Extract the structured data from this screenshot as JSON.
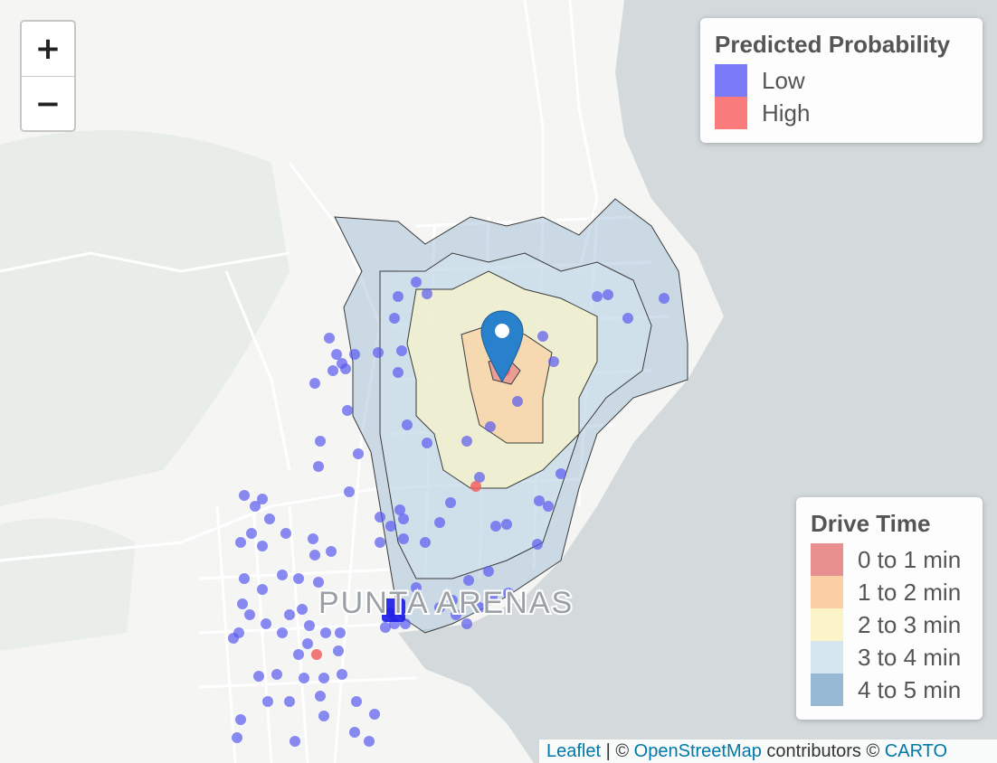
{
  "map": {
    "city_label": "PUNTA ARENAS",
    "colors": {
      "land": "#f5f5f3",
      "water": "#d4dadc",
      "park": "#e6ece6",
      "roads": "#ffffff",
      "point_low": "#5a5af0",
      "point_high": "#f06060",
      "marker": "#2a81cb"
    },
    "marker_icon": "map-pin-icon",
    "layers": [
      "drive-time-isochrones",
      "predicted-probability-points",
      "location-marker"
    ]
  },
  "zoom": {
    "in_label": "+",
    "out_label": "−"
  },
  "legend_probability": {
    "title": "Predicted Probability",
    "items": [
      {
        "label": "Low",
        "color": "#7b7bfa"
      },
      {
        "label": "High",
        "color": "#fa7b7b"
      }
    ]
  },
  "legend_drive_time": {
    "title": "Drive Time",
    "items": [
      {
        "label": "0 to 1 min",
        "color": "#e89090"
      },
      {
        "label": "1 to 2 min",
        "color": "#f9cfa3"
      },
      {
        "label": "2 to 3 min",
        "color": "#fbf4c8"
      },
      {
        "label": "3 to 4 min",
        "color": "#d5e6ef"
      },
      {
        "label": "4 to 5 min",
        "color": "#98b9d5"
      }
    ]
  },
  "attribution": {
    "leaflet": "Leaflet",
    "sep1": " | © ",
    "osm": "OpenStreetMap",
    "contrib": " contributors © ",
    "carto": "CARTO"
  }
}
